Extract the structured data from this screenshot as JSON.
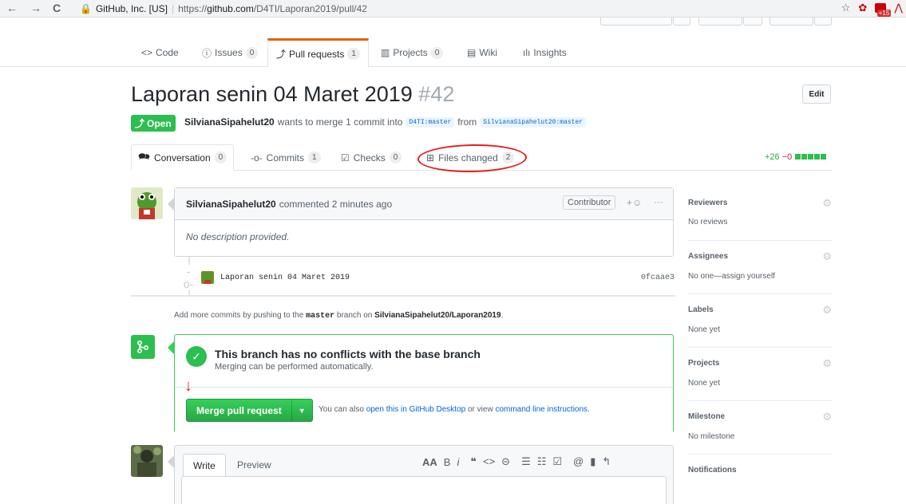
{
  "browser": {
    "back": "←",
    "forward": "→",
    "reload": "C",
    "org": "GitHub, Inc. [US]",
    "url_prefix": "https://",
    "url_host": "github.com",
    "url_path": "/D4TI/Laporan2019/pull/42",
    "ext_badge": "+15"
  },
  "reponav": {
    "code": "Code",
    "issues": "Issues",
    "issues_count": "0",
    "pulls": "Pull requests",
    "pulls_count": "1",
    "projects": "Projects",
    "projects_count": "0",
    "wiki": "Wiki",
    "insights": "Insights"
  },
  "pr": {
    "title": "Laporan senin 04 Maret 2019",
    "number": "#42",
    "edit": "Edit",
    "state": "Open",
    "author": "SilvianaSipahelut20",
    "meta_text": "wants to merge 1 commit into",
    "base_ref": "D4TI:master",
    "from": "from",
    "head_ref": "SilvianaSipahelut20:master"
  },
  "tabs": {
    "conversation": "Conversation",
    "conversation_count": "0",
    "commits": "Commits",
    "commits_count": "1",
    "checks": "Checks",
    "checks_count": "0",
    "files": "Files changed",
    "files_count": "2",
    "additions": "+26",
    "deletions": "−0"
  },
  "comment": {
    "author": "SilvianaSipahelut20",
    "action": "commented 2 minutes ago",
    "role": "Contributor",
    "reaction": "+☺",
    "more": "···",
    "body": "No description provided."
  },
  "commit": {
    "message": "Laporan senin 04 Maret 2019",
    "sha": "0fcaae3"
  },
  "push_hint": {
    "prefix": "Add more commits by pushing to the",
    "branch": "master",
    "middle": "branch on",
    "repo": "SilvianaSipahelut20/Laporan2019",
    "suffix": "."
  },
  "merge": {
    "title": "This branch has no conflicts with the base branch",
    "subtitle": "Merging can be performed automatically.",
    "button": "Merge pull request",
    "alt_prefix": "You can also",
    "alt_link1": "open this in GitHub Desktop",
    "alt_middle": "or view",
    "alt_link2": "command line instructions",
    "alt_suffix": "."
  },
  "form": {
    "write": "Write",
    "preview": "Preview",
    "toolbar_text": [
      "AA",
      "B",
      "i"
    ],
    "toolbar_insert": [
      "❝",
      "<>",
      "⊝"
    ],
    "toolbar_list": [
      "☰",
      "☷",
      "☑"
    ],
    "toolbar_misc": [
      "@",
      "▮",
      "↰"
    ]
  },
  "sidebar": {
    "items": [
      {
        "label": "Reviewers",
        "value": "No reviews"
      },
      {
        "label": "Assignees",
        "value": "No one—assign yourself"
      },
      {
        "label": "Labels",
        "value": "None yet"
      },
      {
        "label": "Projects",
        "value": "None yet"
      },
      {
        "label": "Milestone",
        "value": "No milestone"
      },
      {
        "label": "Notifications",
        "value": ""
      }
    ]
  },
  "colors": {
    "accent": "#0366d6",
    "success": "#2cbe4e",
    "annotation": "#e41e1e",
    "tab_highlight": "#e36209"
  }
}
